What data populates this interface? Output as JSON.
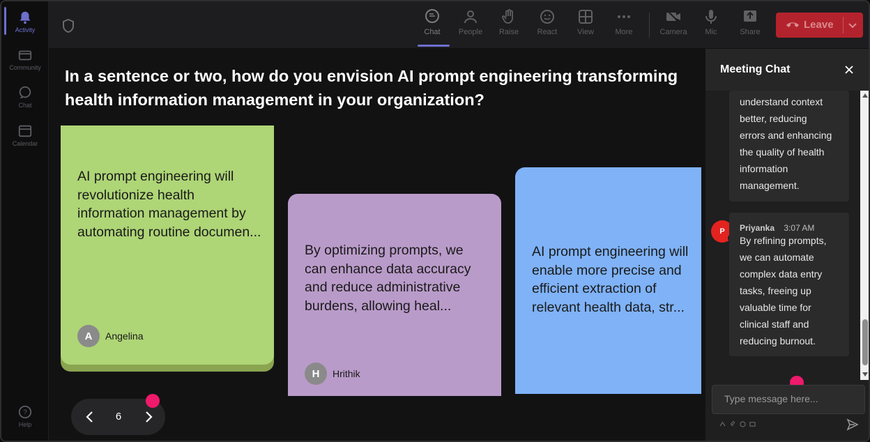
{
  "rail": {
    "items": [
      {
        "label": "Activity",
        "icon": "bell-icon"
      },
      {
        "label": "Community",
        "icon": "community-icon"
      },
      {
        "label": "Chat",
        "icon": "chat-icon"
      },
      {
        "label": "Calendar",
        "icon": "calendar-icon"
      },
      {
        "label": "Help",
        "icon": "help-icon"
      }
    ]
  },
  "toolbar": {
    "buttons": [
      {
        "label": "Chat",
        "icon": "chat-icon"
      },
      {
        "label": "People",
        "icon": "people-icon"
      },
      {
        "label": "Raise",
        "icon": "hand-icon"
      },
      {
        "label": "React",
        "icon": "smiley-icon"
      },
      {
        "label": "View",
        "icon": "grid-icon"
      },
      {
        "label": "More",
        "icon": "more-icon"
      },
      {
        "label": "Camera",
        "icon": "camera-off-icon"
      },
      {
        "label": "Mic",
        "icon": "mic-icon"
      },
      {
        "label": "Share",
        "icon": "share-icon"
      }
    ],
    "leave_label": "Leave"
  },
  "main": {
    "question": "In a sentence or two, how do you envision AI prompt engineering transforming health information management in your organization?",
    "cards": [
      {
        "text": "AI prompt engineering will revolutionize health information management by automating routine documen...",
        "author": "Angelina",
        "initial": "A",
        "color": "#aed576"
      },
      {
        "text": "By optimizing prompts, we can enhance data accuracy and reduce administrative burdens, allowing heal...",
        "author": "Hrithik",
        "initial": "H",
        "color": "#b99bc9"
      },
      {
        "text": "AI prompt engineering will enable more precise and efficient extraction of relevant health data, str...",
        "color": "#7fb2f7"
      }
    ],
    "page_number": "6"
  },
  "chat": {
    "title": "Meeting Chat",
    "messages": [
      {
        "lines": [
          "understand context",
          "better, reducing",
          "errors and enhancing",
          "the quality of health",
          "information",
          "management."
        ]
      },
      {
        "author": "Priyanka",
        "initial": "P",
        "time": "3:07 AM",
        "lines": [
          "By refining prompts,",
          "we can automate",
          "complex data entry",
          "tasks, freeing up",
          "valuable time for",
          "clinical staff and",
          "reducing burnout."
        ]
      }
    ],
    "input_placeholder": "Type message here..."
  }
}
